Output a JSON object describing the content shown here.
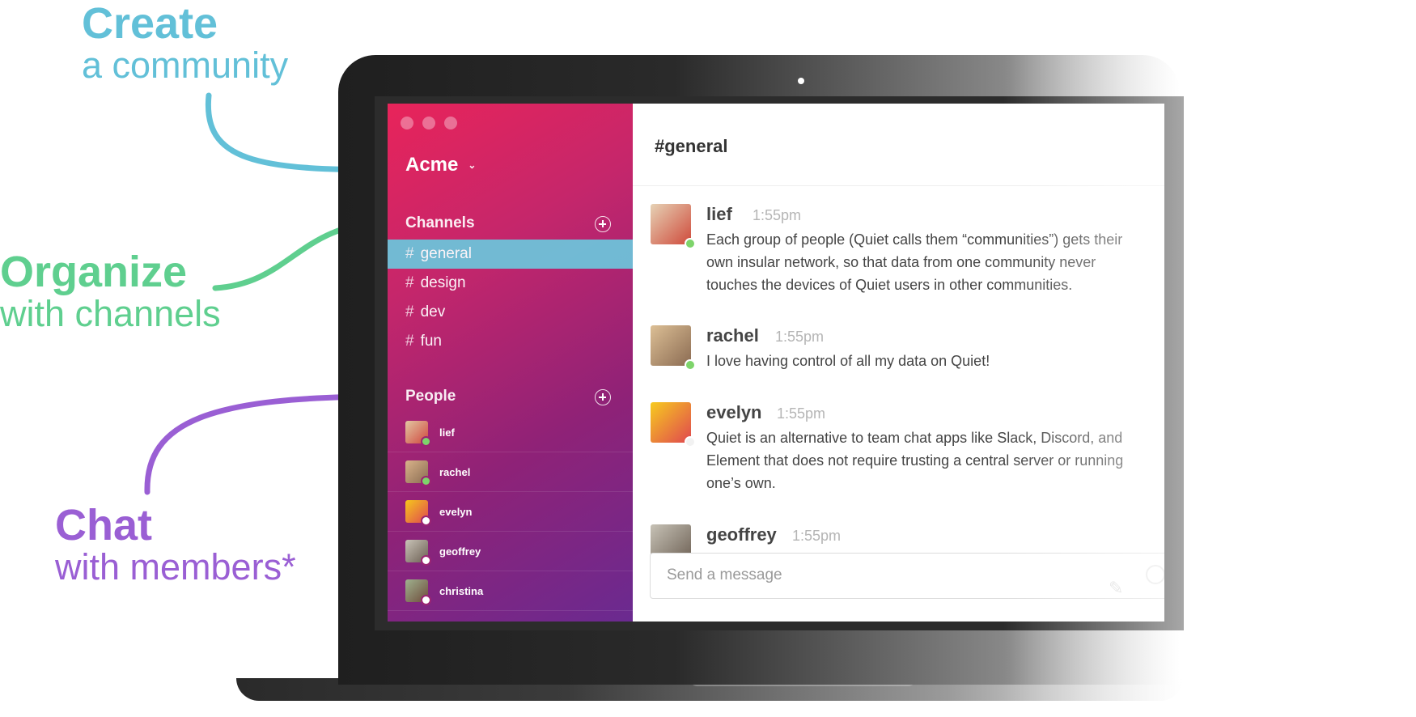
{
  "callouts": {
    "create": {
      "title": "Create",
      "subtitle": "a community"
    },
    "organize": {
      "title": "Organize",
      "subtitle": "with channels"
    },
    "chat": {
      "title": "Chat",
      "subtitle": "with members*"
    }
  },
  "colors": {
    "create": "#62c0d8",
    "organize": "#5fcf8f",
    "chat": "#9a5fd4",
    "active_channel": "#6ec2d9"
  },
  "sidebar": {
    "workspace": "Acme",
    "channels_label": "Channels",
    "channels": [
      {
        "name": "general",
        "active": true
      },
      {
        "name": "design"
      },
      {
        "name": "dev"
      },
      {
        "name": "fun"
      }
    ],
    "people_label": "People",
    "people": [
      {
        "name": "lief",
        "status": "online"
      },
      {
        "name": "rachel",
        "status": "online"
      },
      {
        "name": "evelyn",
        "status": "offline"
      },
      {
        "name": "geoffrey",
        "status": "offline"
      },
      {
        "name": "christina",
        "status": "offline"
      }
    ]
  },
  "main": {
    "channel_title": "#general",
    "messages": [
      {
        "user": "lief",
        "time": "1:55pm",
        "text": "Each group of people (Quiet calls them “communities”) gets their\nown insular network, so that data from one community never\ntouches the devices of Quiet users in other communities."
      },
      {
        "user": "rachel",
        "time": "1:55pm",
        "text": "I love having control of all my data on Quiet!"
      },
      {
        "user": "evelyn",
        "time": "1:55pm",
        "text": "Quiet is an alternative to team chat apps like Slack, Discord, and\nElement that does not require trusting a central server or running\none’s own."
      },
      {
        "user": "geoffrey",
        "time": "1:55pm",
        "text": ""
      }
    ],
    "composer": {
      "placeholder": "Send a message"
    }
  }
}
